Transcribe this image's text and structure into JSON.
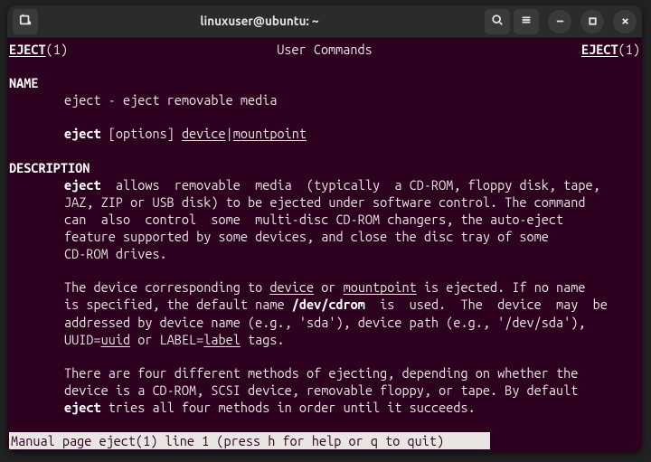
{
  "titlebar": {
    "title": "linuxuser@ubuntu: ~",
    "icons": {
      "newtab": "new-tab-icon",
      "search": "search-icon",
      "menu": "menu-icon",
      "minimize": "minimize-icon",
      "maximize": "maximize-icon",
      "close": "close-icon"
    }
  },
  "header": {
    "left_cmd": "EJECT",
    "left_sect": "(1)",
    "center": "User Commands",
    "right_cmd": "EJECT",
    "right_sect": "(1)"
  },
  "sections": {
    "name": {
      "heading": "NAME",
      "line1": "eject - eject removable media",
      "line2_prefix": "eject",
      "line2_mid": " [options] ",
      "line2_device": "device",
      "line2_pipe": "|",
      "line2_mount": "mountpoint"
    },
    "desc": {
      "heading": "DESCRIPTION",
      "p1_w1": "eject",
      "p1_l1": "  allows  removable  media  (typically  a CD-ROM, floppy disk, tape,",
      "p1_l2": "JAZ, ZIP or USB disk) to be ejected under software control. The command",
      "p1_l3": "can  also  control  some  multi-disc CD-ROM changers, the auto-eject",
      "p1_l4": "feature supported by some devices, and close the disc tray of some",
      "p1_l5": "CD-ROM drives.",
      "p2_a": "The device corresponding to ",
      "p2_dev": "device",
      "p2_b": " or ",
      "p2_mnt": "mountpoint",
      "p2_c": " is ejected. If no name",
      "p2_l2a": "is specified, the default name ",
      "p2_def": "/dev/cdrom",
      "p2_l2b": "  is  used.  The  device  may  be",
      "p2_l3": "addressed by device name (e.g., 'sda'), device path (e.g., '/dev/sda'),",
      "p2_l4a": "UUID=",
      "p2_uuid": "uuid",
      "p2_l4b": " or LABEL=",
      "p2_label": "label",
      "p2_l4c": " tags.",
      "p3_l1": "There are four different methods of ejecting, depending on whether the",
      "p3_l2": "device is a CD-ROM, SCSI device, removable floppy, or tape. By default",
      "p3_w1": "eject",
      "p3_l3": " tries all four methods in order until it succeeds."
    }
  },
  "status": " Manual page eject(1) line 1 (press h for help or q to quit)"
}
